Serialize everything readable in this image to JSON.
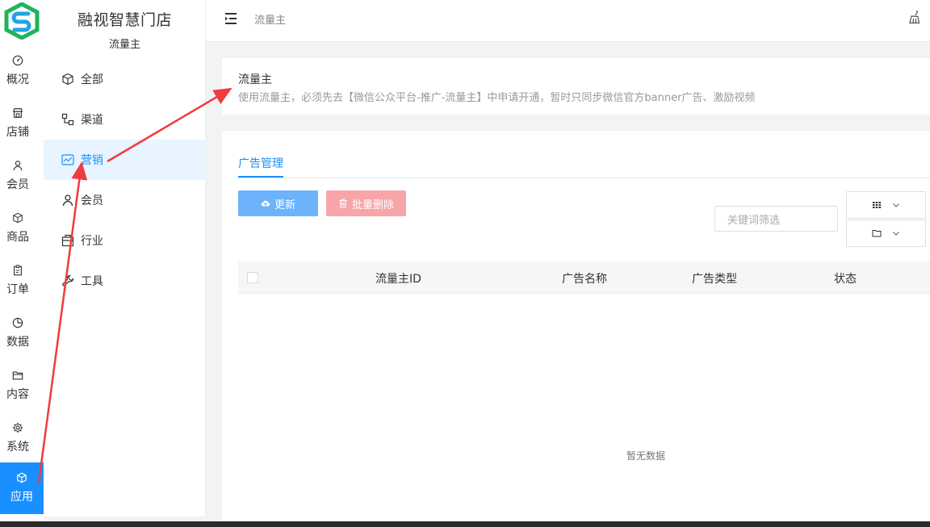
{
  "brand": {
    "store_name": "融视智慧门店",
    "store_sub": "流量主",
    "logo_colors": [
      "#1fa5e0",
      "#1fb45a"
    ]
  },
  "rail": {
    "items": [
      {
        "label": "概况",
        "icon": "dashboard-icon"
      },
      {
        "label": "店铺",
        "icon": "shop-icon"
      },
      {
        "label": "会员",
        "icon": "user-icon"
      },
      {
        "label": "商品",
        "icon": "box-icon"
      },
      {
        "label": "订单",
        "icon": "clipboard-icon"
      },
      {
        "label": "数据",
        "icon": "pie-icon"
      },
      {
        "label": "内容",
        "icon": "folder-icon"
      },
      {
        "label": "系统",
        "icon": "gear-icon"
      },
      {
        "label": "应用",
        "icon": "cube-icon",
        "active": true
      }
    ]
  },
  "sidebar": {
    "items": [
      {
        "label": "全部",
        "icon": "cube-icon"
      },
      {
        "label": "渠道",
        "icon": "channel-icon"
      },
      {
        "label": "营销",
        "icon": "chart-line-icon",
        "active": true
      },
      {
        "label": "会员",
        "icon": "user-icon"
      },
      {
        "label": "行业",
        "icon": "industry-icon"
      },
      {
        "label": "工具",
        "icon": "wrench-icon"
      }
    ]
  },
  "topbar": {
    "breadcrumb": "流量主"
  },
  "header": {
    "title": "流量主",
    "description": "使用流量主，必须先去【微信公众平台-推广-流量主】中申请开通，暂时只同步微信官方banner广告、激励视频"
  },
  "main": {
    "tab_label": "广告管理",
    "refresh_label": "更新",
    "batch_delete_label": "批量删除",
    "search_placeholder": "关键词筛选",
    "columns": [
      "流量主ID",
      "广告名称",
      "广告类型",
      "状态"
    ],
    "empty_text": "暂无数据"
  },
  "colors": {
    "primary": "#1890ff",
    "refresh_button": "#6cb3fb",
    "delete_button": "#f7a5a8",
    "annotation_arrow": "#f03c3c"
  }
}
